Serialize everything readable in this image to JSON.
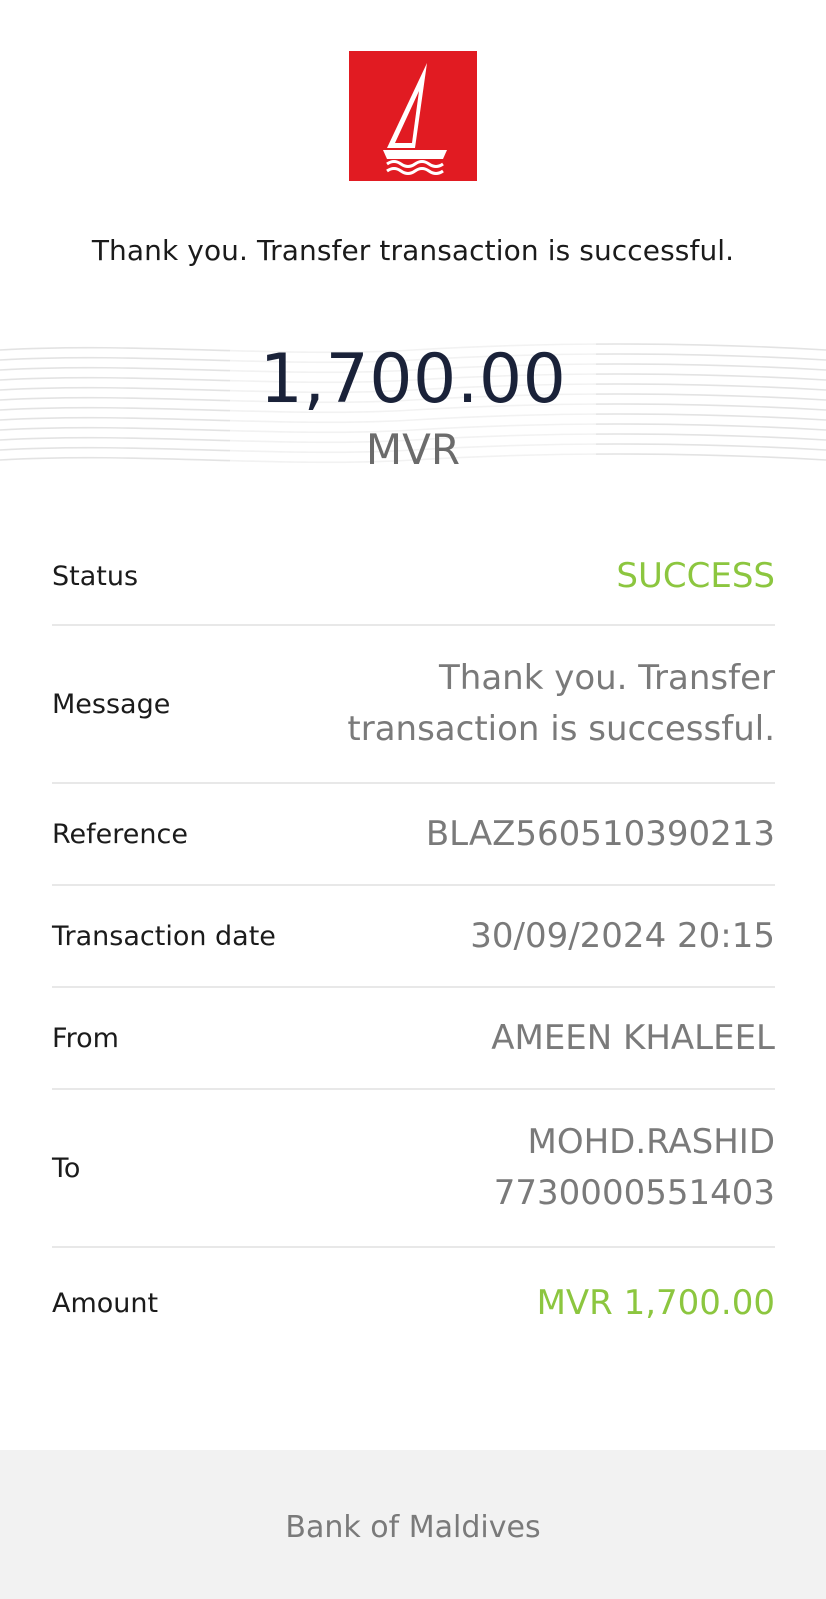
{
  "logo": {
    "icon": "sailboat-icon",
    "background": "#e11b22"
  },
  "headline": "Thank you. Transfer transaction is successful.",
  "amount": {
    "value": "1,700.00",
    "currency": "MVR"
  },
  "details": [
    {
      "label": "Status",
      "value": "SUCCESS",
      "highlight": true
    },
    {
      "label": "Message",
      "value": "Thank you. Transfer\ntransaction is successful.",
      "highlight": false
    },
    {
      "label": "Reference",
      "value": "BLAZ560510390213",
      "highlight": false
    },
    {
      "label": "Transaction date",
      "value": "30/09/2024 20:15",
      "highlight": false
    },
    {
      "label": "From",
      "value": "AMEEN KHALEEL",
      "highlight": false
    },
    {
      "label": "To",
      "value": "MOHD.RASHID\n7730000551403",
      "highlight": false
    },
    {
      "label": "Amount",
      "value": "MVR 1,700.00",
      "highlight": true
    }
  ],
  "footer": "Bank of Maldives",
  "colors": {
    "brand_red": "#e11b22",
    "success_green": "#8cc63f",
    "amount_navy": "#1a2239",
    "muted_gray": "#7a7a7a"
  }
}
